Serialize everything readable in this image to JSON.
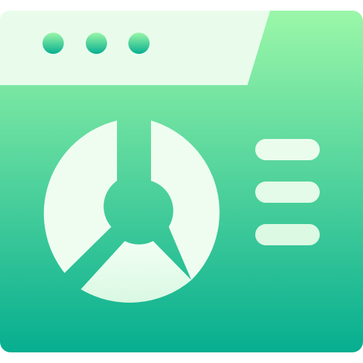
{
  "icon": {
    "name": "dashboard-pie-chart-window-icon",
    "window_dot_count": 3,
    "legend_line_count": 3,
    "pie_segment_count": 3
  },
  "colors": {
    "gradient_top": "#9BF7A8",
    "gradient_bottom": "#06AE90",
    "light_fill": "#E6FCEA"
  }
}
